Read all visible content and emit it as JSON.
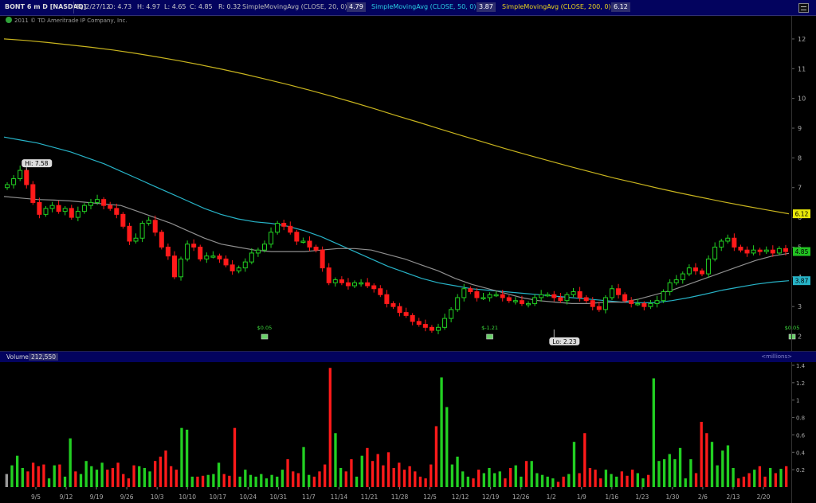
{
  "header": {
    "symbol": "BONT 6 m D [NASDAQ]",
    "date": "D: 2/27/12",
    "open": "O: 4.73",
    "high": "H: 4.97",
    "low": "L: 4.65",
    "close": "C: 4.85",
    "range": "R: 0.32",
    "sma20_label": "SimpleMovingAvg (CLOSE, 20, 0)",
    "sma20_value": "4.79",
    "sma50_label": "SimpleMovingAvg (CLOSE, 50, 0)",
    "sma50_value": "3.87",
    "sma200_label": "SimpleMovingAvg (CLOSE, 200, 0)",
    "sma200_value": "6.12"
  },
  "copyright": "2011 © TD Ameritrade IP Company, Inc.",
  "volume_header": {
    "label": "Volume",
    "value": "212,550",
    "units": "<millions>"
  },
  "colors": {
    "up": "#22d022",
    "down": "#ff1a1a",
    "sma20": "#8f8f8f",
    "sma50": "#27b3c7",
    "sma200": "#c8b41e",
    "header_bg": "#03035e"
  },
  "chart_data": [
    {
      "type": "candlestick",
      "title": "BONT 6 m D [NASDAQ]",
      "x_ticks": [
        "9/5",
        "9/12",
        "9/19",
        "9/26",
        "10/3",
        "10/10",
        "10/17",
        "10/24",
        "10/31",
        "11/7",
        "11/14",
        "11/21",
        "11/28",
        "12/5",
        "12/12",
        "12/19",
        "12/26",
        "1/2",
        "1/9",
        "1/16",
        "1/23",
        "1/30",
        "2/6",
        "2/13",
        "2/20"
      ],
      "y_ticks": [
        2,
        3,
        4,
        5,
        6,
        7,
        8,
        9,
        10,
        11,
        12
      ],
      "ylim": [
        1.8,
        12.4
      ],
      "price_badges": [
        {
          "label": "6.12",
          "value": 6.12,
          "color": "#e7e70a",
          "text_color": "#000"
        },
        {
          "label": "4.85",
          "value": 4.85,
          "color": "#22c322",
          "text_color": "#000"
        },
        {
          "label": "3.87",
          "value": 3.87,
          "color": "#27b3c7",
          "text_color": "#000"
        }
      ],
      "annotations": [
        {
          "text": "Hi: 7.58",
          "value": 7.58,
          "bar": 3
        },
        {
          "text": "Lo: 2.23",
          "value": 2.23,
          "bar": 85
        }
      ],
      "dividends": [
        {
          "text": "$0.05",
          "bar": 40
        },
        {
          "text": "$-1.21",
          "bar": 75
        },
        {
          "text": "$0.05",
          "bar": 122
        }
      ],
      "series_sma20": [
        6.7,
        6.65,
        6.6,
        6.58,
        6.55,
        6.5,
        6.45,
        6.4,
        6.2,
        6.0,
        5.8,
        5.55,
        5.3,
        5.1,
        5.0,
        4.9,
        4.85,
        4.85,
        4.85,
        4.9,
        4.95,
        4.95,
        4.9,
        4.75,
        4.6,
        4.4,
        4.2,
        3.95,
        3.75,
        3.6,
        3.45,
        3.3,
        3.2,
        3.15,
        3.1,
        3.1,
        3.15,
        3.15,
        3.25,
        3.4,
        3.55,
        3.75,
        3.95,
        4.15,
        4.35,
        4.55,
        4.7,
        4.79
      ],
      "series_sma50": [
        8.7,
        8.6,
        8.5,
        8.35,
        8.2,
        8.0,
        7.8,
        7.55,
        7.3,
        7.05,
        6.8,
        6.55,
        6.3,
        6.1,
        5.95,
        5.85,
        5.8,
        5.7,
        5.55,
        5.35,
        5.1,
        4.85,
        4.6,
        4.35,
        4.15,
        3.95,
        3.8,
        3.7,
        3.6,
        3.55,
        3.5,
        3.45,
        3.4,
        3.35,
        3.3,
        3.25,
        3.2,
        3.15,
        3.13,
        3.13,
        3.2,
        3.3,
        3.42,
        3.55,
        3.65,
        3.75,
        3.82,
        3.87
      ],
      "series_sma200": [
        12.0,
        11.95,
        11.88,
        11.8,
        11.72,
        11.63,
        11.52,
        11.4,
        11.27,
        11.13,
        10.98,
        10.82,
        10.65,
        10.47,
        10.28,
        10.08,
        9.87,
        9.65,
        9.42,
        9.2,
        8.97,
        8.75,
        8.53,
        8.31,
        8.1,
        7.9,
        7.7,
        7.51,
        7.32,
        7.15,
        6.98,
        6.82,
        6.67,
        6.52,
        6.38,
        6.25,
        6.12
      ],
      "candles_close": [
        7.1,
        7.3,
        7.58,
        7.1,
        6.5,
        6.1,
        6.3,
        6.4,
        6.2,
        6.3,
        6.0,
        6.2,
        6.4,
        6.5,
        6.6,
        6.4,
        6.3,
        6.1,
        5.7,
        5.2,
        5.3,
        5.8,
        5.9,
        5.5,
        5.0,
        4.7,
        4.0,
        4.6,
        5.1,
        5.0,
        4.6,
        4.7,
        4.7,
        4.6,
        4.4,
        4.2,
        4.3,
        4.5,
        4.8,
        4.9,
        5.1,
        5.5,
        5.8,
        5.7,
        5.5,
        5.2,
        5.2,
        5.0,
        4.9,
        4.3,
        3.8,
        3.9,
        3.8,
        3.7,
        3.8,
        3.8,
        3.7,
        3.6,
        3.4,
        3.1,
        3.0,
        2.8,
        2.7,
        2.5,
        2.4,
        2.3,
        2.2,
        2.3,
        2.6,
        2.9,
        3.3,
        3.6,
        3.5,
        3.3,
        3.3,
        3.4,
        3.4,
        3.3,
        3.2,
        3.2,
        3.1,
        3.1,
        3.3,
        3.4,
        3.4,
        3.3,
        3.2,
        3.4,
        3.5,
        3.3,
        3.2,
        3.0,
        2.9,
        3.3,
        3.6,
        3.4,
        3.2,
        3.1,
        3.1,
        3.0,
        3.1,
        3.2,
        3.5,
        3.8,
        3.9,
        4.1,
        4.3,
        4.2,
        4.1,
        4.6,
        5.0,
        5.2,
        5.3,
        5.0,
        4.9,
        4.8,
        4.9,
        4.85,
        4.9,
        4.8,
        4.95,
        4.85
      ],
      "volume_ylim": [
        0,
        1.4
      ],
      "volume_ticks": [
        0.2,
        0.4,
        0.6,
        0.8,
        1.0,
        1.2,
        1.4
      ],
      "volume": [
        0.15,
        0.25,
        0.36,
        0.22,
        0.18,
        0.28,
        0.24,
        0.26,
        0.1,
        0.25,
        0.26,
        0.12,
        0.56,
        0.18,
        0.15,
        0.3,
        0.24,
        0.2,
        0.28,
        0.2,
        0.22,
        0.28,
        0.15,
        0.1,
        0.25,
        0.24,
        0.22,
        0.18,
        0.3,
        0.35,
        0.42,
        0.24,
        0.2,
        0.68,
        0.66,
        0.12,
        0.12,
        0.13,
        0.14,
        0.15,
        0.28,
        0.15,
        0.13,
        0.68,
        0.12,
        0.2,
        0.14,
        0.12,
        0.15,
        0.1,
        0.14,
        0.12,
        0.2,
        0.32,
        0.18,
        0.16,
        0.46,
        0.14,
        0.12,
        0.18,
        0.26,
        1.37,
        0.62,
        0.22,
        0.18,
        0.32,
        0.12,
        0.36,
        0.45,
        0.3,
        0.38,
        0.25,
        0.4,
        0.22,
        0.28,
        0.2,
        0.24,
        0.18,
        0.12,
        0.1,
        0.26,
        0.7,
        1.26,
        0.92,
        0.26,
        0.35,
        0.18,
        0.12,
        0.1,
        0.2,
        0.16,
        0.22,
        0.16,
        0.18,
        0.1,
        0.22,
        0.25,
        0.12,
        0.3,
        0.3,
        0.16,
        0.14,
        0.12,
        0.1,
        0.06,
        0.12,
        0.15,
        0.52,
        0.16,
        0.62,
        0.22,
        0.2,
        0.1,
        0.2,
        0.15,
        0.12,
        0.18,
        0.13,
        0.2,
        0.16,
        0.1,
        0.14,
        1.25,
        0.3,
        0.32,
        0.38,
        0.32,
        0.45,
        0.1,
        0.32,
        0.16,
        0.75,
        0.62,
        0.52,
        0.25,
        0.42,
        0.48,
        0.22,
        0.1,
        0.12,
        0.16,
        0.2,
        0.24,
        0.12,
        0.22,
        0.16,
        0.21,
        0.24
      ]
    }
  ]
}
